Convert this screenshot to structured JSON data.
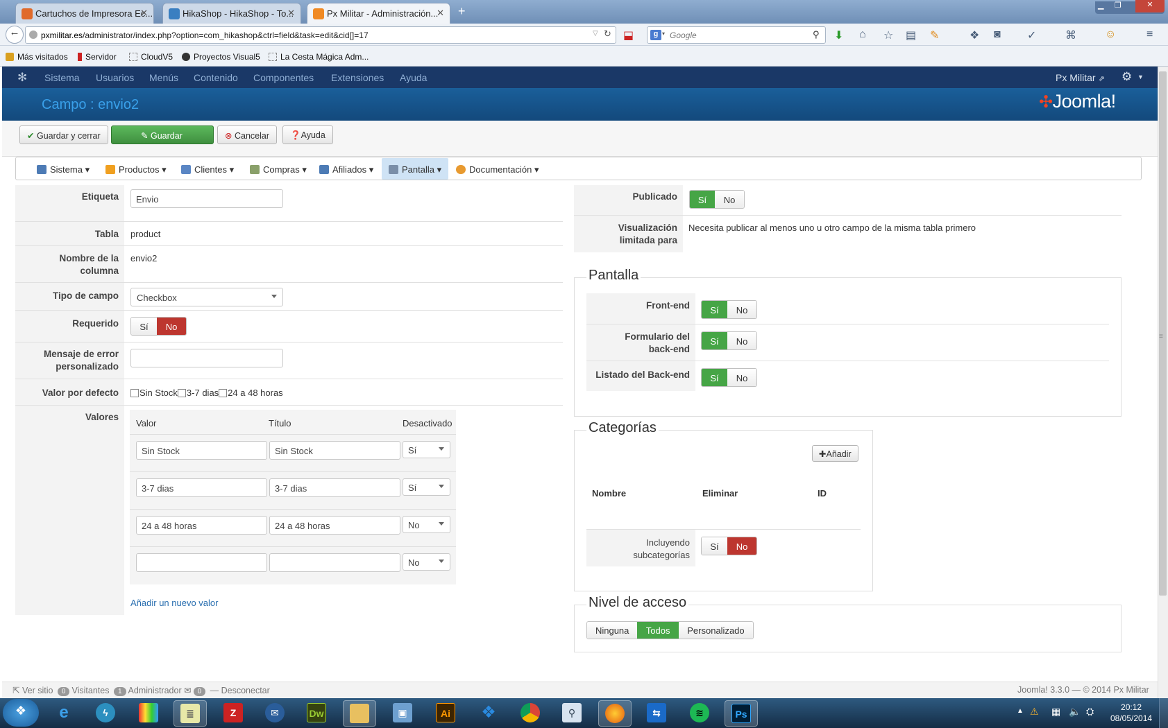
{
  "browser": {
    "tabs": [
      {
        "title": "Cartuchos de Impresora Ec...",
        "active": false
      },
      {
        "title": "HikaShop - HikaShop - To...",
        "active": false
      },
      {
        "title": "Px Militar - Administración...",
        "active": true
      }
    ],
    "new_tab": "+",
    "url_host": "pxmilitar.es",
    "url_path": "/administrator/index.php?option=com_hikashop&ctrl=field&task=edit&cid[]=17",
    "search_placeholder": "Google",
    "bookmarks": [
      "Más visitados",
      "Servidor",
      "CloudV5",
      "Proyectos Visual5",
      "La Cesta Mágica Adm..."
    ]
  },
  "joomla": {
    "nav": [
      "Sistema",
      "Usuarios",
      "Menús",
      "Contenido",
      "Componentes",
      "Extensiones",
      "Ayuda"
    ],
    "user_link": "Px Militar",
    "page_title": "Campo : envio2",
    "logo_text": "Joomla!",
    "toolbar": {
      "save_close": "Guardar y cerrar",
      "save": "Guardar",
      "cancel": "Cancelar",
      "help": "Ayuda"
    },
    "hika_menu": [
      "Sistema",
      "Productos",
      "Clientes",
      "Compras",
      "Afiliados",
      "Pantalla",
      "Documentación"
    ]
  },
  "form": {
    "etiqueta_label": "Etiqueta",
    "etiqueta_value": "Envio",
    "tabla_label": "Tabla",
    "tabla_value": "product",
    "columna_label": "Nombre de la columna",
    "columna_value": "envio2",
    "tipo_label": "Tipo de campo",
    "tipo_value": "Checkbox",
    "requerido_label": "Requerido",
    "yes": "Sí",
    "no": "No",
    "requerido_value": "No",
    "mensaje_label": "Mensaje de error personalizado",
    "mensaje_value": "",
    "defecto_label": "Valor por defecto",
    "defecto_options": [
      "Sin Stock",
      "3-7 dias",
      "24 a 48 horas"
    ],
    "valores_label": "Valores",
    "valores_headers": [
      "Valor",
      "Título",
      "Desactivado"
    ],
    "valores_rows": [
      {
        "valor": "Sin Stock",
        "titulo": "Sin Stock",
        "desactivado": "Sí"
      },
      {
        "valor": "3-7 dias",
        "titulo": "3-7 dias",
        "desactivado": "Sí"
      },
      {
        "valor": "24 a 48 horas",
        "titulo": "24 a 48 horas",
        "desactivado": "No"
      },
      {
        "valor": "",
        "titulo": "",
        "desactivado": "No"
      }
    ],
    "add_value_link": "Añadir un nuevo valor"
  },
  "right": {
    "publicado_label": "Publicado",
    "publicado_value": "Sí",
    "visualizacion_label": "Visualización limitada para",
    "visualizacion_text": "Necesita publicar al menos uno u otro campo de la misma tabla primero",
    "pantalla_legend": "Pantalla",
    "frontend_label": "Front-end",
    "form_backend_label": "Formulario del back-end",
    "listado_backend_label": "Listado del Back-end",
    "categorias_legend": "Categorías",
    "add_button": "Añadir",
    "cat_headers": [
      "Nombre",
      "Eliminar",
      "ID"
    ],
    "subcat_label": "Incluyendo subcategorías",
    "subcat_value": "No",
    "nivel_legend": "Nivel de acceso",
    "nivel_options": [
      "Ninguna",
      "Todos",
      "Personalizado"
    ],
    "nivel_selected": "Todos"
  },
  "footer": {
    "ver_sitio": "Ver sitio",
    "visitantes_count": "0",
    "visitantes": "Visitantes",
    "admin_count": "1",
    "administrador": "Administrador",
    "msg_count": "0",
    "desconectar": "Desconectar",
    "version": "Joomla! 3.3.0 — © 2014 Px Militar"
  },
  "taskbar": {
    "apps": [
      "start",
      "ie",
      "fireworks",
      "picasa",
      "notepad",
      "filezilla",
      "thunderbird",
      "dreamweaver",
      "explorer",
      "remote",
      "illustrator",
      "dropbox",
      "chrome",
      "search",
      "firefox",
      "teamviewer",
      "spotify",
      "photoshop"
    ],
    "time": "20:12",
    "date": "08/05/2014"
  },
  "colors": {
    "joomla_nav": "#1a3867",
    "joomla_header": "#17568c",
    "title_blue": "#39a0ea",
    "green": "#46a546",
    "red": "#bd362f"
  }
}
